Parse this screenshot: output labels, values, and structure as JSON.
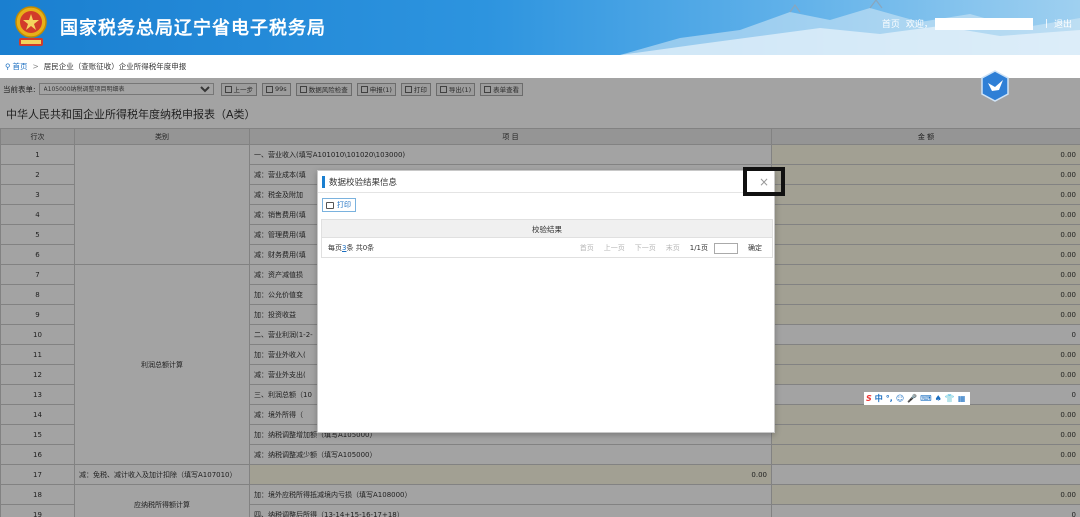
{
  "header": {
    "site_title": "国家税务总局辽宁省电子税务局",
    "home_link": "首页",
    "welcome": "欢迎，",
    "separator": "|",
    "logout": "退出"
  },
  "breadcrumb": {
    "home": "首页",
    "sep": ">",
    "current": "居民企业（查账征收）企业所得税年度申报"
  },
  "toolbar": {
    "form_label": "当前表单:",
    "form_select_value": "A105000纳税调整项目明细表",
    "buttons": [
      "上一步",
      "99s",
      "数据风险检查",
      "申报(1)",
      "打印",
      "导出(1)",
      "表单查看"
    ]
  },
  "report": {
    "title": "中华人民共和国企业所得税年度纳税申报表（A类）",
    "columns": [
      "行次",
      "类别",
      "项 目",
      "金 额"
    ],
    "rows": [
      {
        "no": "1",
        "cat": "",
        "item": "一、营业收入(填写A101010\\101020\\103000)",
        "amt": "0.00",
        "hl": true
      },
      {
        "no": "2",
        "cat": "",
        "item": "减：营业成本(填",
        "amt": "0.00",
        "hl": true
      },
      {
        "no": "3",
        "cat": "",
        "item": "减：税金及附加",
        "amt": "0.00",
        "hl": true
      },
      {
        "no": "4",
        "cat": "",
        "item": "减：销售费用(填",
        "amt": "0.00",
        "hl": true
      },
      {
        "no": "5",
        "cat": "",
        "item": "减：管理费用(填",
        "amt": "0.00",
        "hl": true
      },
      {
        "no": "6",
        "cat": "",
        "item": "减：财务费用(填",
        "amt": "0.00",
        "hl": true
      },
      {
        "no": "7",
        "cat": "利润总额计算",
        "item": "减：资产减值损",
        "amt": "0.00",
        "hl": true
      },
      {
        "no": "8",
        "cat": "",
        "item": "加：公允价值变",
        "amt": "0.00",
        "hl": true
      },
      {
        "no": "9",
        "cat": "",
        "item": "加：投资收益",
        "amt": "0.00",
        "hl": true
      },
      {
        "no": "10",
        "cat": "",
        "item": "二、营业利润(1-2-",
        "amt": "0",
        "hl": false
      },
      {
        "no": "11",
        "cat": "",
        "item": "加：营业外收入(",
        "amt": "0.00",
        "hl": true
      },
      {
        "no": "12",
        "cat": "",
        "item": "减：营业外支出(",
        "amt": "0.00",
        "hl": true
      },
      {
        "no": "13",
        "cat": "",
        "item": "三、利润总额（10",
        "amt": "0",
        "hl": false
      },
      {
        "no": "14",
        "cat": "",
        "item": "减：境外所得（",
        "amt": "0.00",
        "hl": true
      },
      {
        "no": "15",
        "cat": "",
        "item": "加：纳税调整增加额（填写A105000）",
        "amt": "0.00",
        "hl": true
      },
      {
        "no": "16",
        "cat": "",
        "item": "减：纳税调整减少额（填写A105000）",
        "amt": "0.00",
        "hl": true
      },
      {
        "no": "17",
        "cat": "",
        "item": "减：免税、减计收入及加计扣除（填写A107010）",
        "amt": "0.00",
        "hl": true
      },
      {
        "no": "18",
        "cat": "应纳税所得额计算",
        "item": "加：境外应税所得抵减境内亏损（填写A108000）",
        "amt": "0.00",
        "hl": true
      },
      {
        "no": "19",
        "cat": "",
        "item": "四、纳税调整后所得（13-14+15-16-17+18）",
        "amt": "0",
        "hl": false
      }
    ]
  },
  "modal": {
    "title": "数据校验结果信息",
    "close": "×",
    "print_btn": "打印",
    "result_header": "校验结果",
    "pager": {
      "per_page_prefix": "每页",
      "page_size": "3",
      "per_page_suffix": "条 共0条",
      "first": "首页",
      "prev": "上一页",
      "next": "下一页",
      "last": "末页",
      "page_info": "1/1页",
      "confirm": "确定"
    }
  },
  "ime": {
    "logo": "S",
    "lang": "中",
    "symbols": [
      "°,",
      "☺",
      "🎤",
      "⌨",
      "♠",
      "👕",
      "▦"
    ]
  }
}
